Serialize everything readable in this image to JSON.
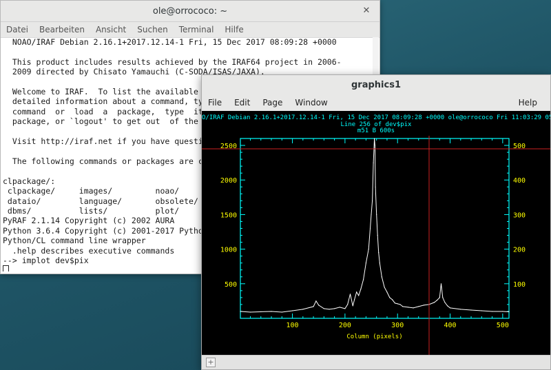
{
  "terminal": {
    "title": "ole@orrococo: ~",
    "menu": [
      "Datei",
      "Bearbeiten",
      "Ansicht",
      "Suchen",
      "Terminal",
      "Hilfe"
    ],
    "lines": [
      "  NOAO/IRAF Debian 2.16.1+2017.12.14-1 Fri, 15 Dec 2017 08:09:28 +0000",
      "",
      "  This product includes results achieved by the IRAF64 project in 2006-",
      "  2009 directed by Chisato Yamauchi (C-SODA/ISAS/JAXA).",
      "",
      "  Welcome to IRAF.  To list the available c",
      "  detailed information about a command, typ",
      "  command  or  load  a  package,  type  its",
      "  package, or `logout' to get out  of the C",
      "",
      "  Visit http://iraf.net if you have questio",
      "",
      "  The following commands or packages are cu",
      "",
      "clpackage/:",
      " clpackage/     images/         noao/",
      " dataio/        language/       obsolete/",
      " dbms/          lists/          plot/",
      "PyRAF 2.1.14 Copyright (c) 2002 AURA",
      "Python 3.6.4 Copyright (c) 2001-2017 Python",
      "Python/CL command line wrapper",
      "  .help describes executive commands",
      "--> implot dev$pix"
    ]
  },
  "graphics": {
    "title": "graphics1",
    "menu": {
      "file": "File",
      "edit": "Edit",
      "page": "Page",
      "window": "Window",
      "help": "Help"
    },
    "header_line1": "O/IRAF Debian 2.16.1+2017.12.14-1 Fri, 15 Dec 2017 08:09:28 +0000 ole@orrococo Fri 11:03:29 05-Jan-2",
    "header_line2": "Line 256 of dev$pix",
    "header_line3": "m51  B  600s",
    "xlabel": "Column (pixels)",
    "plot_color": "#00ffff",
    "label_color": "#ffff00",
    "crosshair_color": "#cc2222"
  },
  "chart_data": {
    "type": "line",
    "title": "Line 256 of dev$pix",
    "subtitle": "m51  B  600s",
    "xlabel": "Column (pixels)",
    "ylabel": "",
    "xlim": [
      1,
      512
    ],
    "ylim": [
      0,
      2600
    ],
    "xticks": [
      100,
      200,
      300,
      400,
      500
    ],
    "yticks_left": [
      500,
      1000,
      1500,
      2000,
      2500
    ],
    "yticks_right": [
      100,
      200,
      300,
      400,
      500
    ],
    "crosshair": {
      "x": 360,
      "y": 2450
    },
    "series": [
      {
        "x": [
          1,
          20,
          40,
          60,
          80,
          100,
          120,
          140,
          145,
          150,
          160,
          170,
          180,
          190,
          200,
          205,
          210,
          215,
          218,
          222,
          226,
          230,
          235,
          240,
          245,
          248,
          250,
          252,
          254,
          256,
          257,
          258,
          260,
          262,
          264,
          266,
          270,
          275,
          280,
          285,
          290,
          295,
          300,
          305,
          310,
          320,
          330,
          340,
          350,
          360,
          370,
          375,
          380,
          383,
          386,
          390,
          395,
          400,
          420,
          440,
          460,
          480,
          500,
          512
        ],
        "y": [
          100,
          90,
          95,
          100,
          90,
          110,
          130,
          170,
          250,
          190,
          140,
          130,
          140,
          160,
          140,
          200,
          350,
          180,
          270,
          380,
          330,
          420,
          560,
          800,
          1000,
          1300,
          1500,
          1700,
          2250,
          2600,
          2500,
          1900,
          1500,
          1200,
          950,
          800,
          600,
          450,
          380,
          300,
          270,
          220,
          210,
          200,
          170,
          160,
          150,
          170,
          190,
          200,
          230,
          260,
          300,
          500,
          300,
          230,
          180,
          150,
          130,
          120,
          110,
          100,
          100,
          95
        ]
      }
    ]
  }
}
